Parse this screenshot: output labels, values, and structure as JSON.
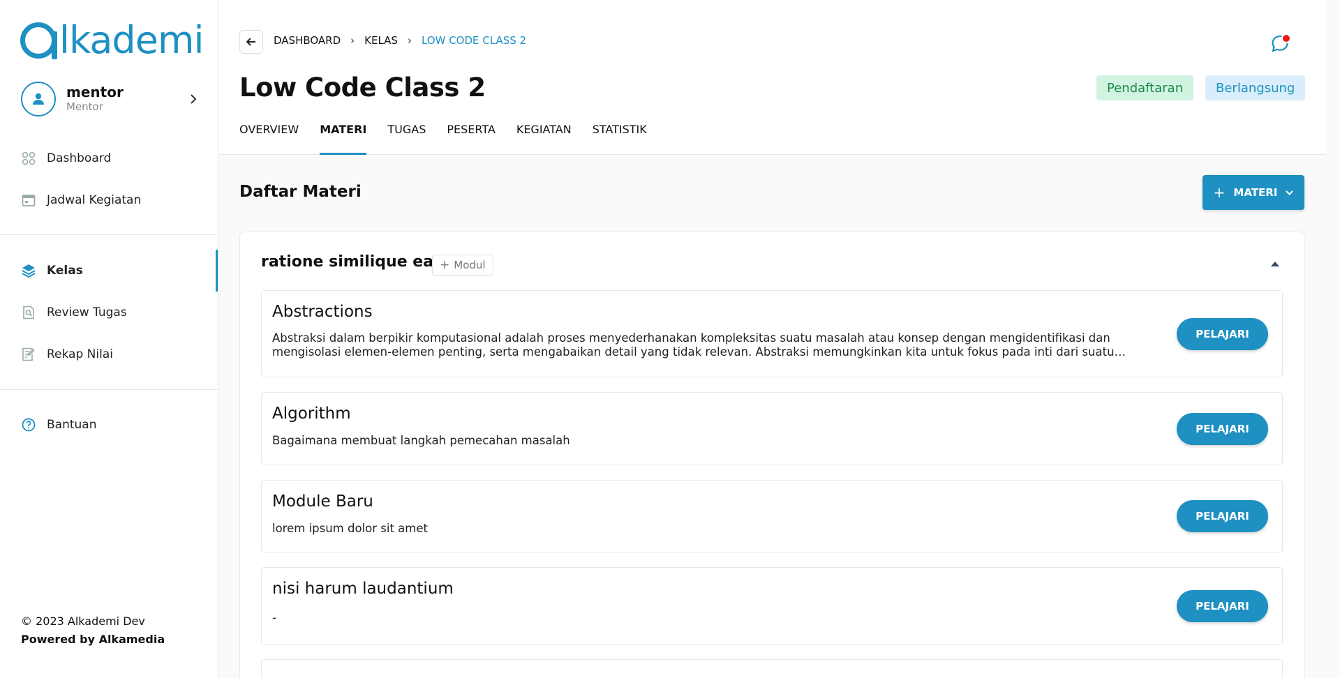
{
  "brand": {
    "logo_text": "lkademi",
    "color": "#1e90c2"
  },
  "user": {
    "name": "mentor",
    "role": "Mentor"
  },
  "sidebar": {
    "items": [
      {
        "label": "Dashboard",
        "icon": "dashboard-grid-icon"
      },
      {
        "label": "Jadwal Kegiatan",
        "icon": "calendar-icon"
      },
      {
        "label": "Kelas",
        "icon": "layers-icon",
        "active": true
      },
      {
        "label": "Review Tugas",
        "icon": "review-search-icon"
      },
      {
        "label": "Rekap Nilai",
        "icon": "edit-list-icon"
      },
      {
        "label": "Bantuan",
        "icon": "help-circle-icon"
      }
    ]
  },
  "footer": {
    "copyright": "© 2023 Alkademi Dev",
    "powered": "Powered by Alkamedia"
  },
  "breadcrumb": {
    "items": [
      "DASHBOARD",
      "KELAS",
      "LOW CODE CLASS 2"
    ]
  },
  "page": {
    "title": "Low Code Class 2",
    "badges": [
      {
        "label": "Pendaftaran",
        "color": "#1a8a4c"
      },
      {
        "label": "Berlangsung",
        "color": "#1e90c2"
      }
    ],
    "tabs": [
      "OVERVIEW",
      "MATERI",
      "TUGAS",
      "PESERTA",
      "KEGIATAN",
      "STATISTIK"
    ],
    "active_tab": "MATERI"
  },
  "materi": {
    "section_title": "Daftar Materi",
    "add_button": "MATERI",
    "module": {
      "title": "ratione similique ea",
      "add_modul_label": "Modul",
      "items": [
        {
          "title": "Abstractions",
          "description": "Abstraksi dalam berpikir komputasional adalah proses menyederhanakan kompleksitas suatu masalah atau konsep dengan mengidentifikasi dan mengisolasi elemen-elemen penting, serta mengabaikan detail yang tidak relevan. Abstraksi memungkinkan kita untuk fokus pada inti dari suatu masalah dan memudahkan pemahaman.",
          "button": "PELAJARI"
        },
        {
          "title": "Algorithm",
          "description": "Bagaimana membuat langkah pemecahan masalah",
          "button": "PELAJARI"
        },
        {
          "title": "Module Baru",
          "description": "lorem ipsum dolor sit amet",
          "button": "PELAJARI"
        },
        {
          "title": "nisi harum laudantium",
          "description": "-",
          "button": "PELAJARI"
        }
      ]
    }
  }
}
